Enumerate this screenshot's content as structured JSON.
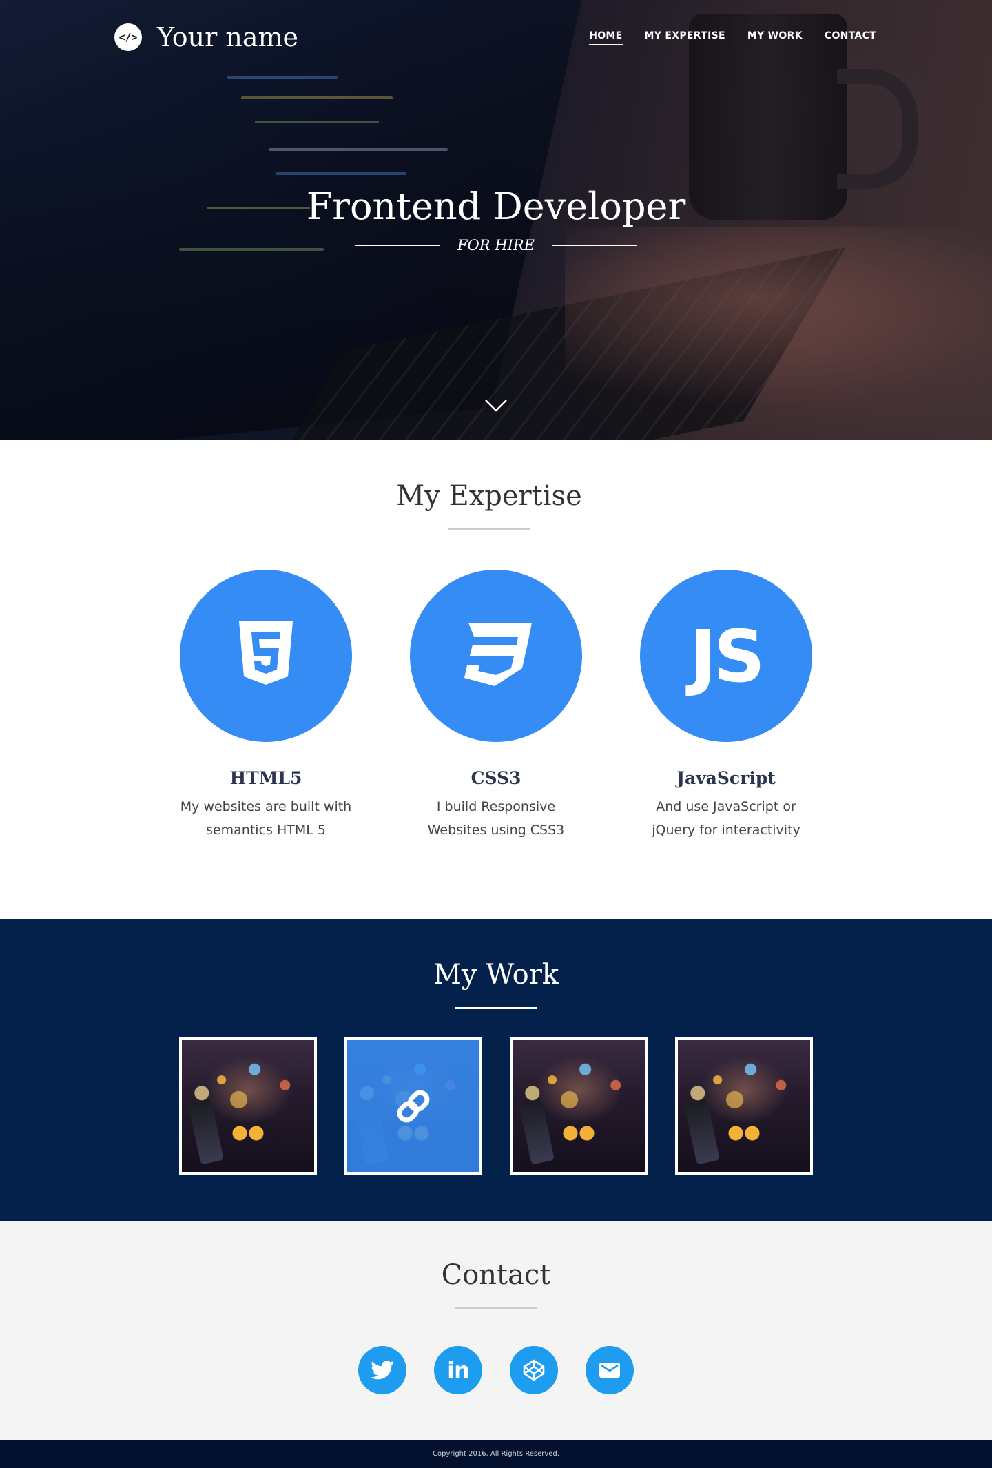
{
  "header": {
    "brand_icon": "</>",
    "brand_name": "Your name",
    "nav": [
      {
        "label": "HOME",
        "active": true
      },
      {
        "label": "MY EXPERTISE",
        "active": false
      },
      {
        "label": "MY WORK",
        "active": false
      },
      {
        "label": "CONTACT",
        "active": false
      }
    ]
  },
  "hero": {
    "title": "Frontend Developer",
    "subtitle": "FOR HIRE",
    "scroll_icon": "chevron-down-icon"
  },
  "expertise": {
    "title": "My Expertise",
    "skills": [
      {
        "icon": "html5-icon",
        "title": "HTML5",
        "description": "My websites are built with semantics HTML 5"
      },
      {
        "icon": "css3-icon",
        "title": "CSS3",
        "description": "I build Responsive Websites using CSS3"
      },
      {
        "icon": "javascript-icon",
        "icon_text": "JS",
        "title": "JavaScript",
        "description": "And use JavaScript or jQuery for interactivity"
      }
    ]
  },
  "work": {
    "title": "My Work",
    "items": [
      {
        "hovered": false
      },
      {
        "hovered": true,
        "icon": "link-icon"
      },
      {
        "hovered": false
      },
      {
        "hovered": false
      }
    ]
  },
  "contact": {
    "title": "Contact",
    "socials": [
      {
        "icon": "twitter-icon"
      },
      {
        "icon": "linkedin-icon",
        "text": "in"
      },
      {
        "icon": "codepen-icon"
      },
      {
        "icon": "email-icon"
      }
    ]
  },
  "footer": {
    "copyright": "Copyright 2016, All Rights Reserved."
  },
  "colors": {
    "accent_blue": "#368cf5",
    "social_blue": "#1e9cf0",
    "work_bg": "#03214b",
    "footer_bg": "#03112e"
  }
}
